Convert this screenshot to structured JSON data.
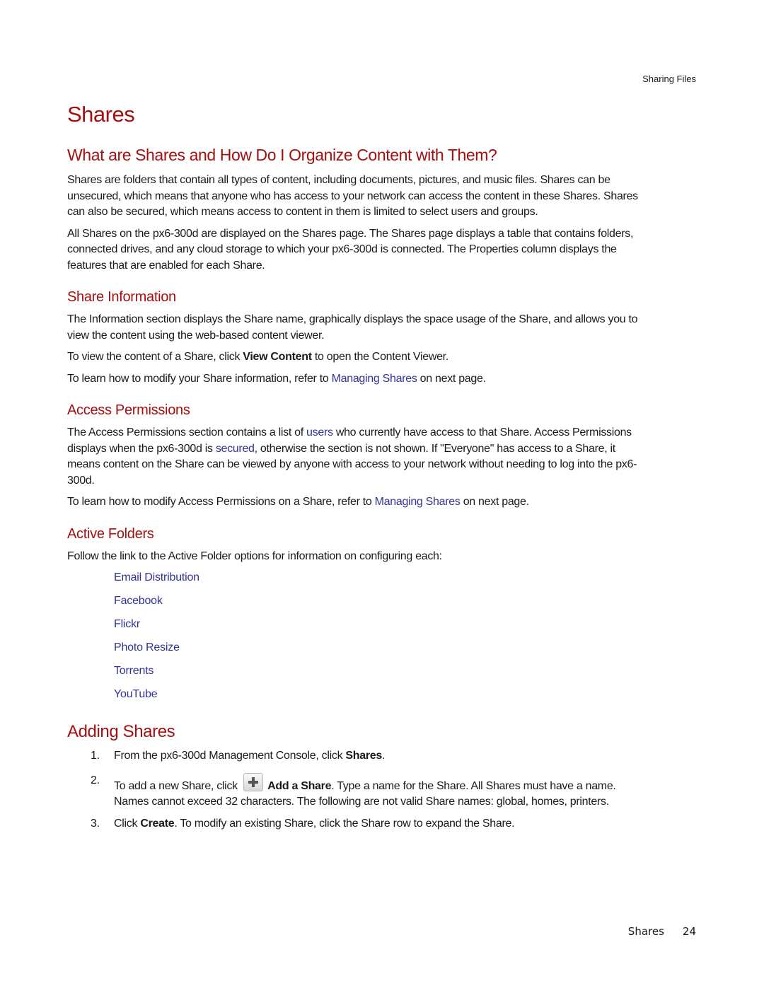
{
  "running_head": "Sharing Files",
  "title": "Shares",
  "intro": {
    "heading": "What are Shares and How Do I Organize Content with Them?",
    "paragraphs": [
      "Shares are folders that contain all types of content, including documents, pictures, and music files. Shares can be unsecured, which means that anyone who has access to your network can access the content in these Shares. Shares can also be secured, which means access to content in them is limited to select users and groups.",
      "All Shares on the px6-300d are displayed on the Shares page. The Shares page displays a table that contains folders, connected drives, and any cloud storage to which your px6-300d is connected. The Properties column displays the features that are enabled for each Share."
    ]
  },
  "share_information": {
    "heading": "Share Information",
    "p1": "The Information section displays the Share name, graphically displays the space usage of the Share, and allows you to view the content using the web-based content viewer.",
    "p2_pre": "To view the content of a Share, click ",
    "p2_bold": "View Content",
    "p2_post": " to open the Content Viewer.",
    "p3_pre": "To learn how to modify your Share information, refer to ",
    "p3_link": "Managing Shares",
    "p3_post": " on next page."
  },
  "access_permissions": {
    "heading": "Access Permissions",
    "p1_a": "The Access Permissions section contains a list of ",
    "p1_link1": "users",
    "p1_b": " who currently have access to that Share. Access Permissions displays when the px6-300d is ",
    "p1_link2": "secured",
    "p1_c": ", otherwise the section is not shown. If \"Everyone\" has access to a Share, it means content on the Share can be viewed by anyone with access to your network without needing to log into the px6-300d.",
    "p2_pre": "To learn how to modify Access Permissions on a Share, refer to ",
    "p2_link": "Managing Shares",
    "p2_post": " on next page."
  },
  "active_folders": {
    "heading": "Active Folders",
    "intro": "Follow the link to the Active Folder options for information on configuring each:",
    "links": [
      "Email Distribution",
      "Facebook",
      "Flickr",
      "Photo Resize",
      "Torrents",
      "YouTube"
    ]
  },
  "adding_shares": {
    "heading": "Adding Shares",
    "steps": [
      {
        "num": "1.",
        "pre": "From the px6-300d Management Console, click ",
        "bold": "Shares",
        "post": "."
      },
      {
        "num": "2.",
        "pre": "To add a new Share, click ",
        "icon": "add-share-icon",
        "bold": "Add a Share",
        "post": ". Type a name for the Share. All Shares must have a name. Names cannot exceed 32 characters. The following are not valid Share names: global, homes, printers."
      },
      {
        "num": "3.",
        "pre": "Click ",
        "bold": "Create",
        "post": ". To modify an existing Share, click the Share row to expand the Share."
      }
    ]
  },
  "footer": {
    "section": "Shares",
    "page_number": "24"
  },
  "colors": {
    "heading": "#a50f0f",
    "link": "#333399",
    "text": "#1a1a1a"
  }
}
